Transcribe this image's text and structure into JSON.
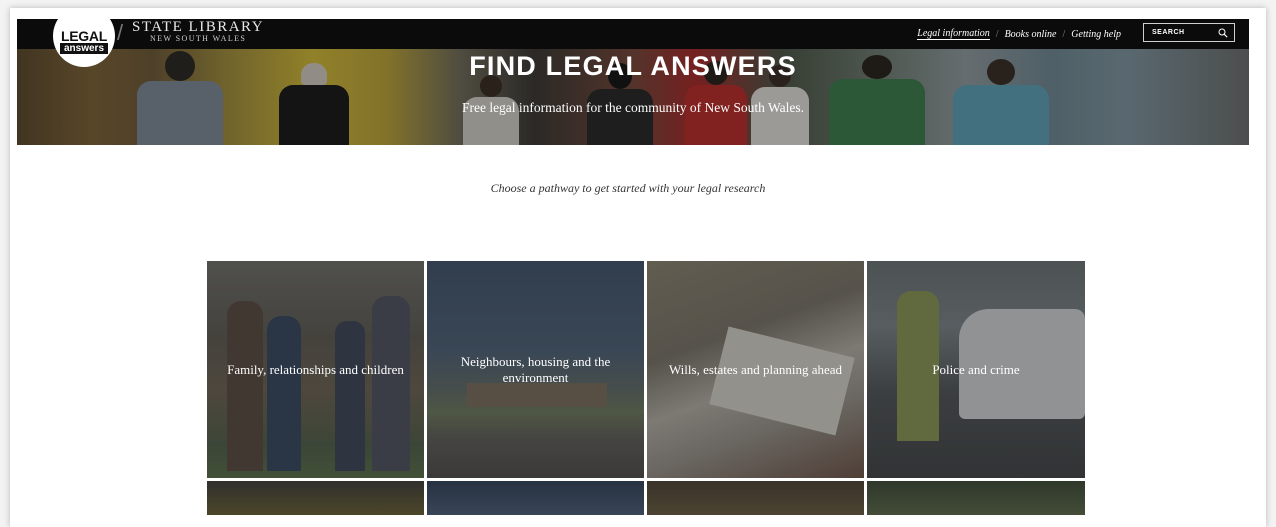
{
  "header": {
    "logo_top": "LEGAL",
    "logo_bottom": "answers",
    "library_title": "STATE LIBRARY",
    "library_subtitle": "NEW SOUTH WALES",
    "nav": [
      {
        "label": "Legal information",
        "active": true
      },
      {
        "label": "Books online",
        "active": false
      },
      {
        "label": "Getting help",
        "active": false
      }
    ],
    "nav_separator": "/",
    "search_placeholder": "SEARCH",
    "search_icon": "search-icon"
  },
  "hero": {
    "title": "FIND LEGAL ANSWERS",
    "subtitle": "Free legal information for the community of New South Wales."
  },
  "intro": "Choose a pathway to get started with your legal research",
  "pathways": [
    {
      "label": "Family, relationships and children"
    },
    {
      "label": "Neighbours, housing and the environment"
    },
    {
      "label": "Wills, estates and planning ahead"
    },
    {
      "label": "Police and crime"
    }
  ]
}
